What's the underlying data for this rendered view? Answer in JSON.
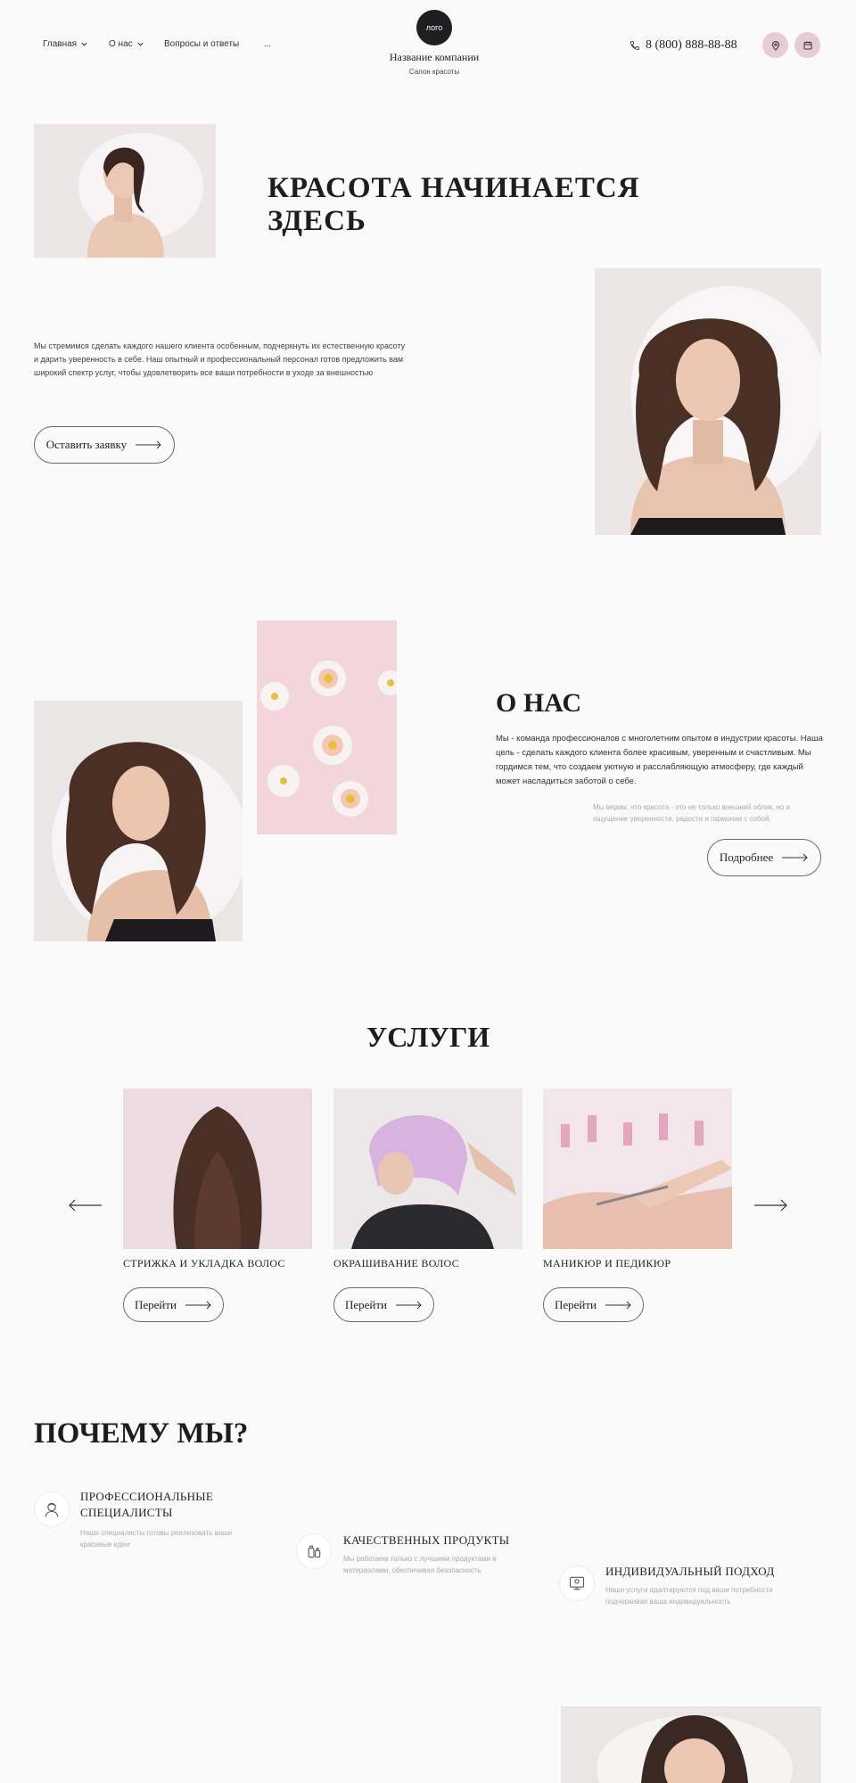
{
  "header": {
    "nav": [
      {
        "label": "Главная",
        "has_dropdown": true
      },
      {
        "label": "О нас",
        "has_dropdown": true
      },
      {
        "label": "Вопросы и ответы",
        "has_dropdown": false
      },
      {
        "label": "...",
        "has_dropdown": false
      }
    ],
    "logo_text": "лого",
    "company_name": "Название компании",
    "tagline": "Салон красоты",
    "phone": "8 (800) 888-88-88",
    "icons": [
      "phone-icon",
      "map-pin-icon",
      "calendar-icon"
    ]
  },
  "hero": {
    "title": "КРАСОТА НАЧИНАЕТСЯ ЗДЕСЬ",
    "text": "Мы стремимся сделать каждого нашего клиента особенным, подчеркнуть их естественную красоту и дарить уверенность в себе. Наш опытный и профессиональный персонал готов предложить вам широкий спектр услуг, чтобы удовлетворить все ваши потребности в уходе за внешностью",
    "cta_label": "Оставить заявку"
  },
  "about": {
    "title": "О НАС",
    "text": "Мы - команда профессионалов с многолетним опытом в индустрии красоты. Наша цель - сделать каждого клиента более красивым, уверенным и счастливым. Мы гордимся тем, что создаем уютную и расслабляющую атмосферу, где каждый может насладиться заботой о себе.",
    "quote": "Мы верим, что красота - это не только внешний облик, но и ощущение уверенности, радости и гармонии с собой.",
    "more_label": "Подробнее"
  },
  "services": {
    "title": "УСЛУГИ",
    "items": [
      {
        "name": "СТРИЖКА И УКЛАДКА ВОЛОС",
        "button": "Перейти"
      },
      {
        "name": "ОКРАШИВАНИЕ ВОЛОС",
        "button": "Перейти"
      },
      {
        "name": "МАНИКЮР И ПЕДИКЮР",
        "button": "Перейти"
      }
    ]
  },
  "why": {
    "title": "ПОЧЕМУ МЫ?",
    "features": [
      {
        "title": "ПРОФЕССИОНАЛЬНЫЕ СПЕЦИАЛИСТЫ",
        "desc": "Наши специалисты готовы реализовать ваши красивые идеи",
        "icon": "specialist-icon"
      },
      {
        "title": "КАЧЕСТВЕННЫХ ПРОДУКТЫ",
        "desc": "Мы работаем только с лучшими продуктами и материалами, обеспечивая безопасность",
        "icon": "products-icon"
      },
      {
        "title": "ИНДИВИДУАЛЬНЫЙ ПОДХОД",
        "desc": "Наши услуги адаптируются под ваши потребности подчеркивая ваша индивидуальность",
        "icon": "individual-approach-icon"
      }
    ]
  },
  "colors": {
    "background": "#fbfafa",
    "accent_pink": "#e6cdd5",
    "logo_dark": "#1f1f22",
    "text": "#1d1d1f",
    "muted": "#aaaaaa"
  }
}
